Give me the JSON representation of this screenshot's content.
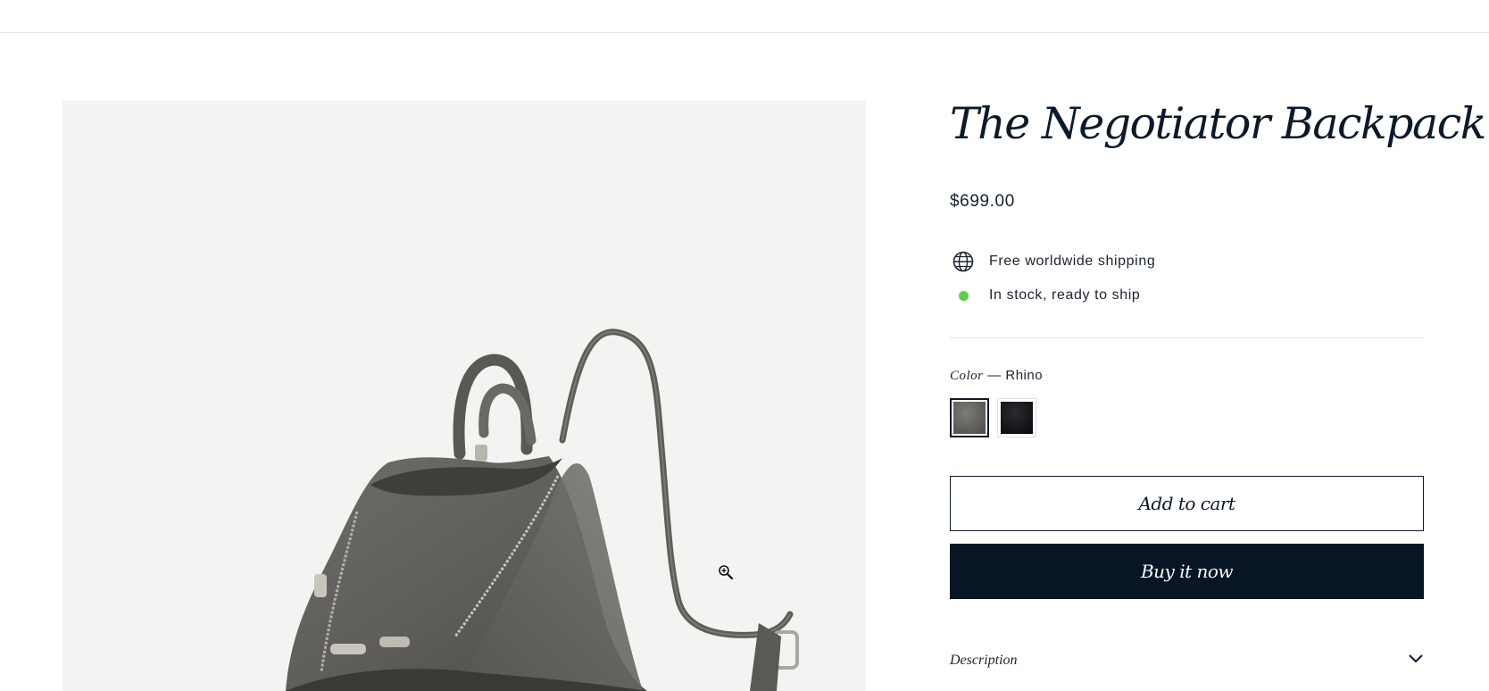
{
  "product": {
    "title": "The Negotiator Backpack",
    "price": "$699.00",
    "info": [
      {
        "icon": "globe-icon",
        "text": "Free worldwide shipping"
      },
      {
        "icon": "in-stock-dot-icon",
        "text": "In stock, ready to ship",
        "color": "#5fcf4a"
      }
    ],
    "color": {
      "label": "Color",
      "separator": "—",
      "selected": "Rhino",
      "swatches": [
        {
          "name": "Rhino",
          "color": "#6b6a66",
          "selected": true
        },
        {
          "name": "Black",
          "color": "#111316",
          "selected": false
        }
      ]
    },
    "buttons": {
      "add_to_cart": "Add to cart",
      "buy_now": "Buy it now"
    },
    "accordion": {
      "description_label": "Description",
      "icon": "chevron-down-icon"
    }
  },
  "gallery": {
    "image": "backpack-photo",
    "zoom_icon": "zoom-in-icon"
  },
  "colors": {
    "brand_dark": "#071524",
    "gallery_bg": "#f3f3f2",
    "in_stock": "#5fcf4a"
  }
}
